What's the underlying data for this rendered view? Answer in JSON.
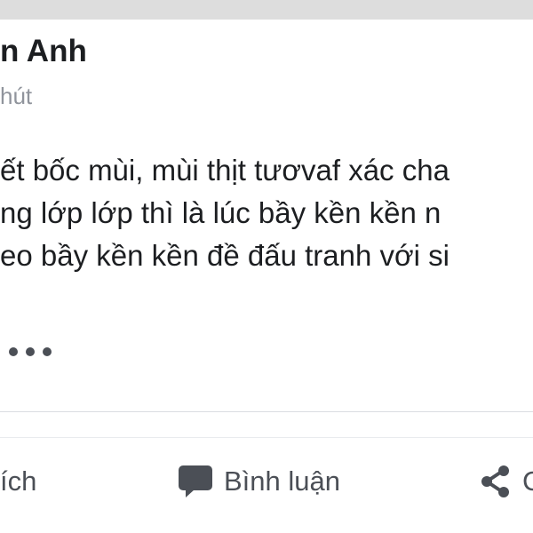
{
  "post": {
    "author": "n Anh",
    "time": "hút",
    "body_lines": [
      "ết bốc mùi, mùi thịt tươvaf xác cha",
      "ng lớp lớp thì là lúc bầy kền kền n",
      "eo bầy kền kền đề đấu tranh với si"
    ]
  },
  "actions": {
    "like_label": "ích",
    "comment_label": "Bình luận",
    "share_label": "C"
  },
  "icons": {
    "more": "more-dots-icon",
    "comment": "comment-bubble-icon",
    "share": "share-icon"
  },
  "colors": {
    "text": "#1c1e21",
    "muted": "#90949c",
    "action": "#4b4f56",
    "top_bar": "#dddddd"
  }
}
